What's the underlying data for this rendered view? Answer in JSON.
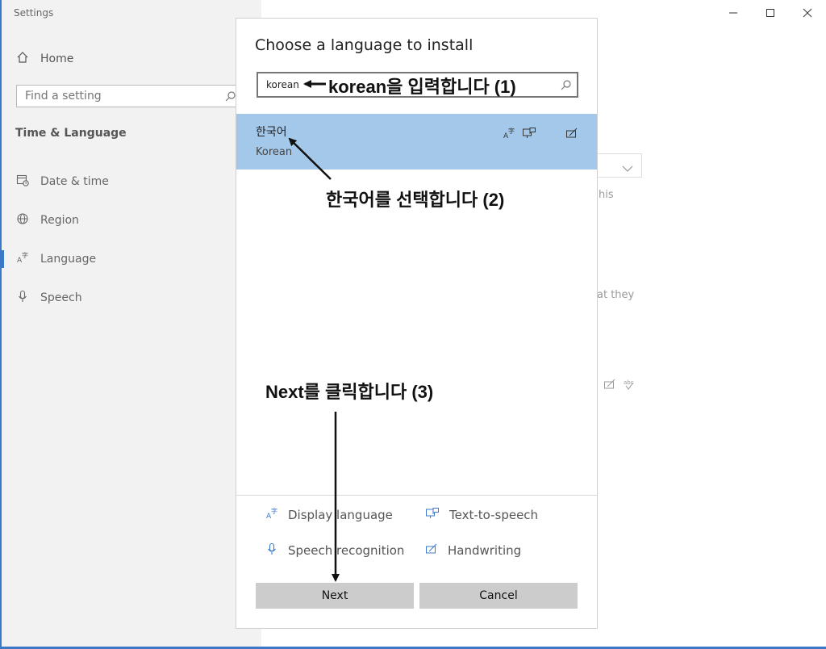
{
  "window": {
    "app_title": "Settings",
    "controls": {
      "minimize": "–",
      "maximize": "☐",
      "close": "✕"
    }
  },
  "sidebar": {
    "home_label": "Home",
    "search_placeholder": "Find a setting",
    "section_title": "Time & Language",
    "items": [
      {
        "label": "Date & time",
        "icon": "calendar-clock-icon"
      },
      {
        "label": "Region",
        "icon": "globe-icon"
      },
      {
        "label": "Language",
        "icon": "language-icon",
        "active": true
      },
      {
        "label": "Speech",
        "icon": "microphone-icon"
      }
    ]
  },
  "background": {
    "text_fragment_1": "his",
    "text_fragment_2": "at they"
  },
  "dialog": {
    "title": "Choose a language to install",
    "search_value": "korean",
    "result": {
      "native_name": "한국어",
      "english_name": "Korean"
    },
    "legend": [
      {
        "label": "Display language",
        "icon": "display-language-icon"
      },
      {
        "label": "Text-to-speech",
        "icon": "text-to-speech-icon"
      },
      {
        "label": "Speech recognition",
        "icon": "speech-recognition-icon"
      },
      {
        "label": "Handwriting",
        "icon": "handwriting-icon"
      }
    ],
    "next_label": "Next",
    "cancel_label": "Cancel"
  },
  "annotations": {
    "step1": "korean을 입력합니다 (1)",
    "step2": "한국어를 선택합니다 (2)",
    "step3": "Next를 클릭합니다 (3)"
  },
  "colors": {
    "accent": "#3c78c8",
    "selected_row": "#a4c8ea",
    "sidebar_bg": "#f2f2f2",
    "button_bg": "#cccccc"
  }
}
